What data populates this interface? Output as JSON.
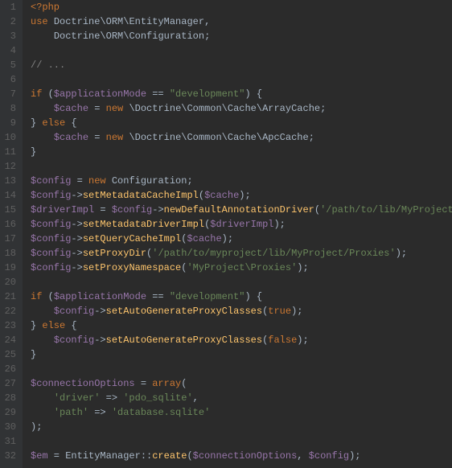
{
  "lines": [
    {
      "num": "1",
      "tokens": [
        {
          "t": "<?php",
          "c": "kw"
        }
      ]
    },
    {
      "num": "2",
      "tokens": [
        {
          "t": "use ",
          "c": "kw"
        },
        {
          "t": "Doctrine",
          "c": "pale"
        },
        {
          "t": "\\",
          "c": "op"
        },
        {
          "t": "ORM",
          "c": "pale"
        },
        {
          "t": "\\",
          "c": "op"
        },
        {
          "t": "EntityManager",
          "c": "pale"
        },
        {
          "t": ",",
          "c": "op"
        }
      ]
    },
    {
      "num": "3",
      "tokens": [
        {
          "t": "    ",
          "c": "op"
        },
        {
          "t": "Doctrine",
          "c": "pale"
        },
        {
          "t": "\\",
          "c": "op"
        },
        {
          "t": "ORM",
          "c": "pale"
        },
        {
          "t": "\\",
          "c": "op"
        },
        {
          "t": "Configuration",
          "c": "pale"
        },
        {
          "t": ";",
          "c": "op"
        }
      ]
    },
    {
      "num": "4",
      "tokens": []
    },
    {
      "num": "5",
      "tokens": [
        {
          "t": "// ...",
          "c": "comment"
        }
      ]
    },
    {
      "num": "6",
      "tokens": []
    },
    {
      "num": "7",
      "tokens": [
        {
          "t": "if ",
          "c": "kw"
        },
        {
          "t": "(",
          "c": "op"
        },
        {
          "t": "$applicationMode",
          "c": "var"
        },
        {
          "t": " == ",
          "c": "op"
        },
        {
          "t": "\"development\"",
          "c": "str"
        },
        {
          "t": ") {",
          "c": "op"
        }
      ]
    },
    {
      "num": "8",
      "tokens": [
        {
          "t": "    ",
          "c": "op"
        },
        {
          "t": "$cache",
          "c": "var"
        },
        {
          "t": " = ",
          "c": "op"
        },
        {
          "t": "new ",
          "c": "kw"
        },
        {
          "t": "\\Doctrine\\Common\\Cache\\ArrayCache",
          "c": "pale"
        },
        {
          "t": ";",
          "c": "op"
        }
      ]
    },
    {
      "num": "9",
      "tokens": [
        {
          "t": "} ",
          "c": "op"
        },
        {
          "t": "else ",
          "c": "kw"
        },
        {
          "t": "{",
          "c": "op"
        }
      ]
    },
    {
      "num": "10",
      "tokens": [
        {
          "t": "    ",
          "c": "op"
        },
        {
          "t": "$cache",
          "c": "var"
        },
        {
          "t": " = ",
          "c": "op"
        },
        {
          "t": "new ",
          "c": "kw"
        },
        {
          "t": "\\Doctrine\\Common\\Cache\\ApcCache",
          "c": "pale"
        },
        {
          "t": ";",
          "c": "op"
        }
      ]
    },
    {
      "num": "11",
      "tokens": [
        {
          "t": "}",
          "c": "op"
        }
      ]
    },
    {
      "num": "12",
      "tokens": []
    },
    {
      "num": "13",
      "tokens": [
        {
          "t": "$config",
          "c": "var"
        },
        {
          "t": " = ",
          "c": "op"
        },
        {
          "t": "new ",
          "c": "kw"
        },
        {
          "t": "Configuration",
          "c": "pale"
        },
        {
          "t": ";",
          "c": "op"
        }
      ]
    },
    {
      "num": "14",
      "tokens": [
        {
          "t": "$config",
          "c": "var"
        },
        {
          "t": "->",
          "c": "op"
        },
        {
          "t": "setMetadataCacheImpl",
          "c": "fn"
        },
        {
          "t": "(",
          "c": "op"
        },
        {
          "t": "$cache",
          "c": "var"
        },
        {
          "t": ");",
          "c": "op"
        }
      ]
    },
    {
      "num": "15",
      "tokens": [
        {
          "t": "$driverImpl",
          "c": "var"
        },
        {
          "t": " = ",
          "c": "op"
        },
        {
          "t": "$config",
          "c": "var"
        },
        {
          "t": "->",
          "c": "op"
        },
        {
          "t": "newDefaultAnnotationDriver",
          "c": "fn"
        },
        {
          "t": "(",
          "c": "op"
        },
        {
          "t": "'/path/to/lib/MyProject/Entities'",
          "c": "str"
        },
        {
          "t": ");",
          "c": "op"
        }
      ]
    },
    {
      "num": "16",
      "tokens": [
        {
          "t": "$config",
          "c": "var"
        },
        {
          "t": "->",
          "c": "op"
        },
        {
          "t": "setMetadataDriverImpl",
          "c": "fn"
        },
        {
          "t": "(",
          "c": "op"
        },
        {
          "t": "$driverImpl",
          "c": "var"
        },
        {
          "t": ");",
          "c": "op"
        }
      ]
    },
    {
      "num": "17",
      "tokens": [
        {
          "t": "$config",
          "c": "var"
        },
        {
          "t": "->",
          "c": "op"
        },
        {
          "t": "setQueryCacheImpl",
          "c": "fn"
        },
        {
          "t": "(",
          "c": "op"
        },
        {
          "t": "$cache",
          "c": "var"
        },
        {
          "t": ");",
          "c": "op"
        }
      ]
    },
    {
      "num": "18",
      "tokens": [
        {
          "t": "$config",
          "c": "var"
        },
        {
          "t": "->",
          "c": "op"
        },
        {
          "t": "setProxyDir",
          "c": "fn"
        },
        {
          "t": "(",
          "c": "op"
        },
        {
          "t": "'/path/to/myproject/lib/MyProject/Proxies'",
          "c": "str"
        },
        {
          "t": ");",
          "c": "op"
        }
      ]
    },
    {
      "num": "19",
      "tokens": [
        {
          "t": "$config",
          "c": "var"
        },
        {
          "t": "->",
          "c": "op"
        },
        {
          "t": "setProxyNamespace",
          "c": "fn"
        },
        {
          "t": "(",
          "c": "op"
        },
        {
          "t": "'MyProject\\Proxies'",
          "c": "str"
        },
        {
          "t": ");",
          "c": "op"
        }
      ]
    },
    {
      "num": "20",
      "tokens": []
    },
    {
      "num": "21",
      "tokens": [
        {
          "t": "if ",
          "c": "kw"
        },
        {
          "t": "(",
          "c": "op"
        },
        {
          "t": "$applicationMode",
          "c": "var"
        },
        {
          "t": " == ",
          "c": "op"
        },
        {
          "t": "\"development\"",
          "c": "str"
        },
        {
          "t": ") {",
          "c": "op"
        }
      ]
    },
    {
      "num": "22",
      "tokens": [
        {
          "t": "    ",
          "c": "op"
        },
        {
          "t": "$config",
          "c": "var"
        },
        {
          "t": "->",
          "c": "op"
        },
        {
          "t": "setAutoGenerateProxyClasses",
          "c": "fn"
        },
        {
          "t": "(",
          "c": "op"
        },
        {
          "t": "true",
          "c": "bool"
        },
        {
          "t": ");",
          "c": "op"
        }
      ]
    },
    {
      "num": "23",
      "tokens": [
        {
          "t": "} ",
          "c": "op"
        },
        {
          "t": "else ",
          "c": "kw"
        },
        {
          "t": "{",
          "c": "op"
        }
      ]
    },
    {
      "num": "24",
      "tokens": [
        {
          "t": "    ",
          "c": "op"
        },
        {
          "t": "$config",
          "c": "var"
        },
        {
          "t": "->",
          "c": "op"
        },
        {
          "t": "setAutoGenerateProxyClasses",
          "c": "fn"
        },
        {
          "t": "(",
          "c": "op"
        },
        {
          "t": "false",
          "c": "bool"
        },
        {
          "t": ");",
          "c": "op"
        }
      ]
    },
    {
      "num": "25",
      "tokens": [
        {
          "t": "}",
          "c": "op"
        }
      ]
    },
    {
      "num": "26",
      "tokens": []
    },
    {
      "num": "27",
      "tokens": [
        {
          "t": "$connectionOptions",
          "c": "var"
        },
        {
          "t": " = ",
          "c": "op"
        },
        {
          "t": "array",
          "c": "kw"
        },
        {
          "t": "(",
          "c": "op"
        }
      ]
    },
    {
      "num": "28",
      "tokens": [
        {
          "t": "    ",
          "c": "op"
        },
        {
          "t": "'driver'",
          "c": "str"
        },
        {
          "t": " => ",
          "c": "op"
        },
        {
          "t": "'pdo_sqlite'",
          "c": "str"
        },
        {
          "t": ",",
          "c": "op"
        }
      ]
    },
    {
      "num": "29",
      "tokens": [
        {
          "t": "    ",
          "c": "op"
        },
        {
          "t": "'path'",
          "c": "str"
        },
        {
          "t": " => ",
          "c": "op"
        },
        {
          "t": "'database.sqlite'",
          "c": "str"
        }
      ]
    },
    {
      "num": "30",
      "tokens": [
        {
          "t": ");",
          "c": "op"
        }
      ]
    },
    {
      "num": "31",
      "tokens": []
    },
    {
      "num": "32",
      "tokens": [
        {
          "t": "$em",
          "c": "var"
        },
        {
          "t": " = EntityManager::",
          "c": "op"
        },
        {
          "t": "create",
          "c": "fn"
        },
        {
          "t": "(",
          "c": "op"
        },
        {
          "t": "$connectionOptions",
          "c": "var"
        },
        {
          "t": ", ",
          "c": "op"
        },
        {
          "t": "$config",
          "c": "var"
        },
        {
          "t": ");",
          "c": "op"
        }
      ]
    }
  ]
}
